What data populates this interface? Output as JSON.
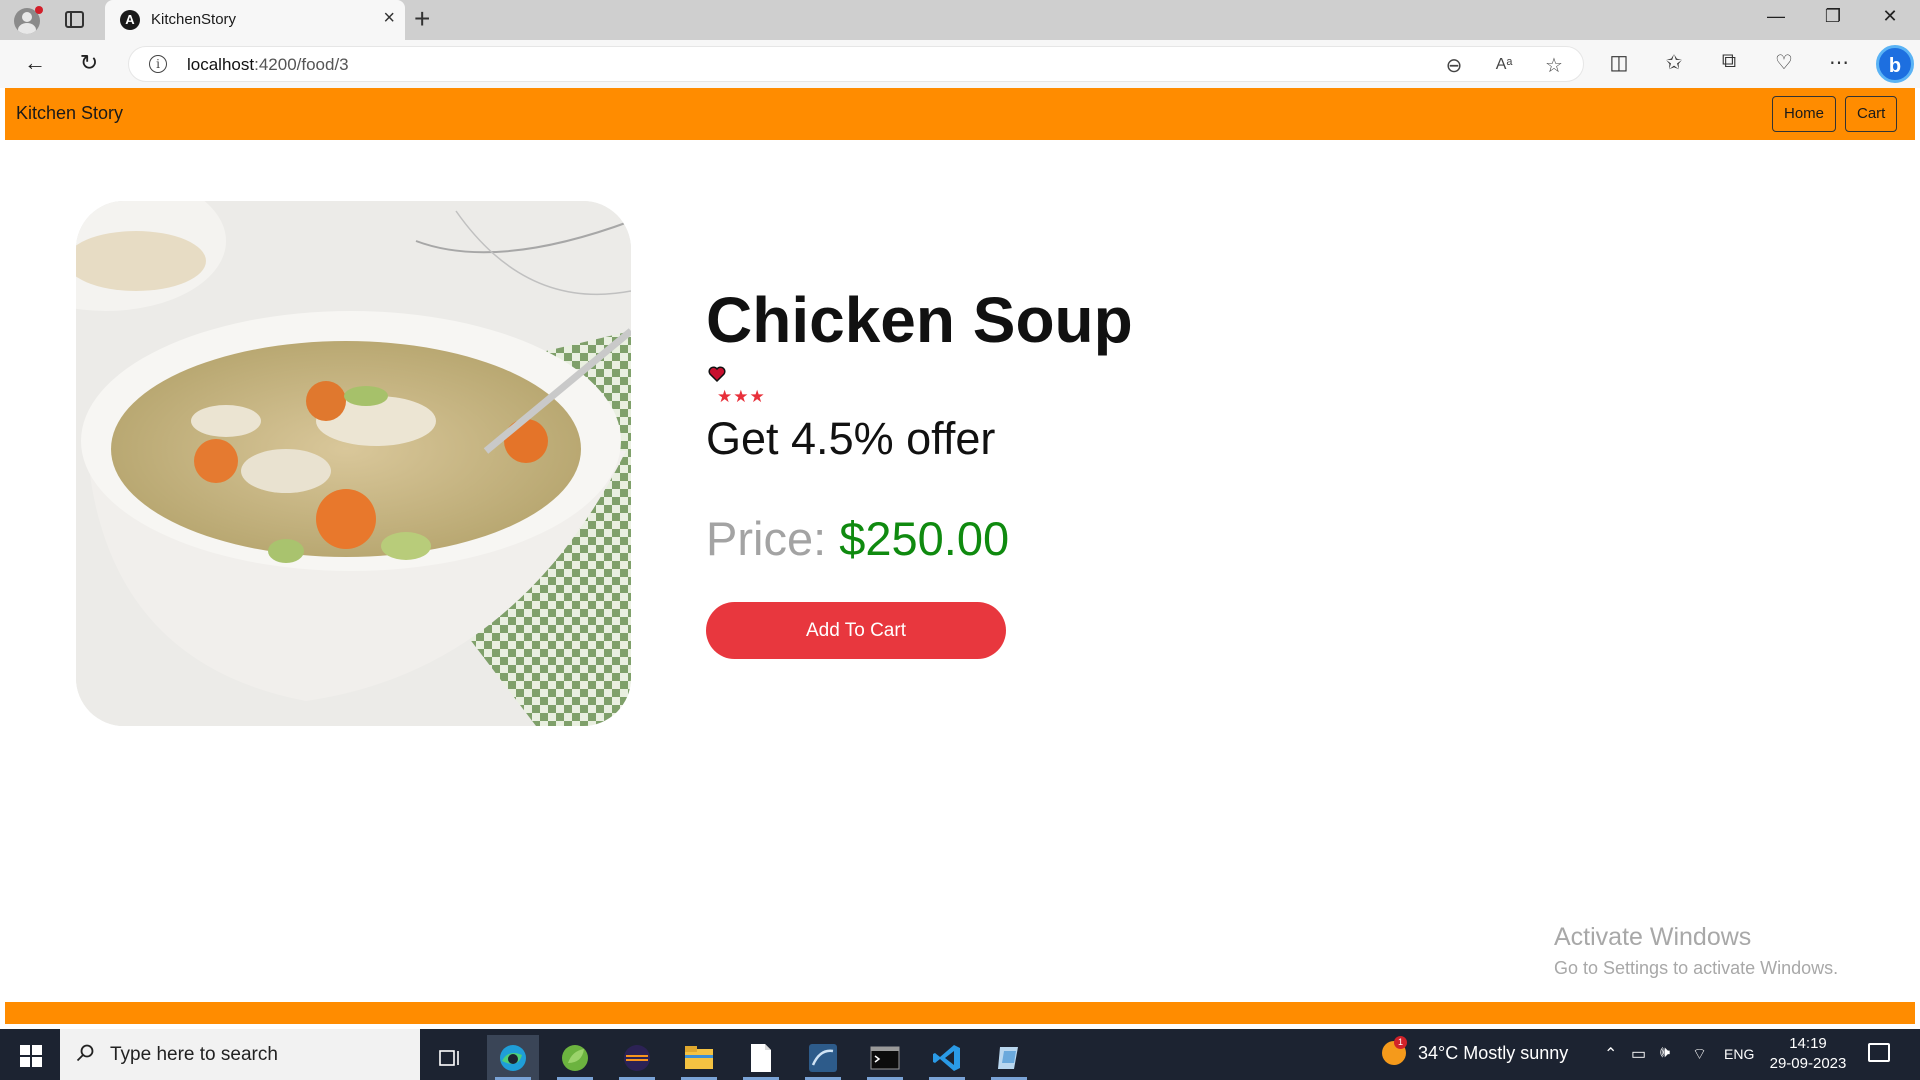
{
  "browser": {
    "tab_title": "KitchenStory",
    "tab_favicon_letter": "A",
    "url_host": "localhost",
    "url_path": ":4200/food/3"
  },
  "app": {
    "brand": "Kitchen Story",
    "nav": {
      "home_label": "Home",
      "cart_label": "Cart"
    }
  },
  "food": {
    "name": "Chicken Soup",
    "favorite": true,
    "stars": 3,
    "stars_text": "★★★",
    "offer_text": "Get 4.5% offer",
    "price_label": "Price:",
    "price_value": "$250.00",
    "add_to_cart_label": "Add To Cart"
  },
  "watermark": {
    "line1": "Activate Windows",
    "line2": "Go to Settings to activate Windows."
  },
  "taskbar": {
    "search_placeholder": "Type here to search",
    "weather_badge": "1",
    "weather": "34°C  Mostly sunny",
    "language": "ENG",
    "time": "14:19",
    "date": "29-09-2023"
  },
  "colors": {
    "header": "#ff8c00",
    "add_to_cart": "#e8373e",
    "price_value": "#0f8a0f",
    "stars": "#e8303a"
  }
}
